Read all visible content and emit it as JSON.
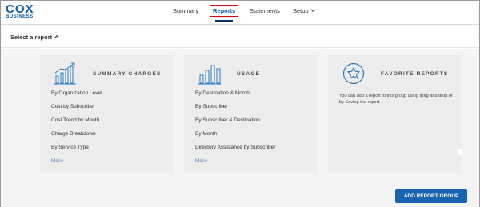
{
  "brand": {
    "name": "COX",
    "subtitle": "BUSINESS",
    "color": "#0b5fa8"
  },
  "nav": {
    "items": [
      {
        "label": "Summary",
        "active": false
      },
      {
        "label": "Reports",
        "active": true
      },
      {
        "label": "Statements",
        "active": false
      },
      {
        "label": "Setup",
        "active": false,
        "has_dropdown": true
      }
    ]
  },
  "subbar": {
    "label": "Select a report",
    "icon": "chevron-up-icon"
  },
  "cards": [
    {
      "title": "SUMMARY CHARGES",
      "icon": "bar-chart-trend-icon",
      "items": [
        "By Organization Level",
        "Cost by Subscriber",
        "Cost Trend by Month",
        "Charge Breakdown",
        "By Service Type"
      ],
      "more": "More"
    },
    {
      "title": "USAGE",
      "icon": "bar-chart-icon",
      "items": [
        "By Destination & Month",
        "By Subscriber",
        "By Subscriber & Destination",
        "By Month",
        "Directory Assistance by Subscriber"
      ],
      "more": "More"
    },
    {
      "title": "FAVORITE REPORTS",
      "icon": "star-circle-icon",
      "description": "You can add a report to this group using drag and drop or by Saving the report."
    }
  ],
  "actions": {
    "add_report_group": "ADD REPORT GROUP"
  },
  "colors": {
    "accent": "#1a63b0",
    "highlight_border": "#e3000f",
    "card_bg": "#ededed",
    "page_bg": "#f4f4f4"
  }
}
